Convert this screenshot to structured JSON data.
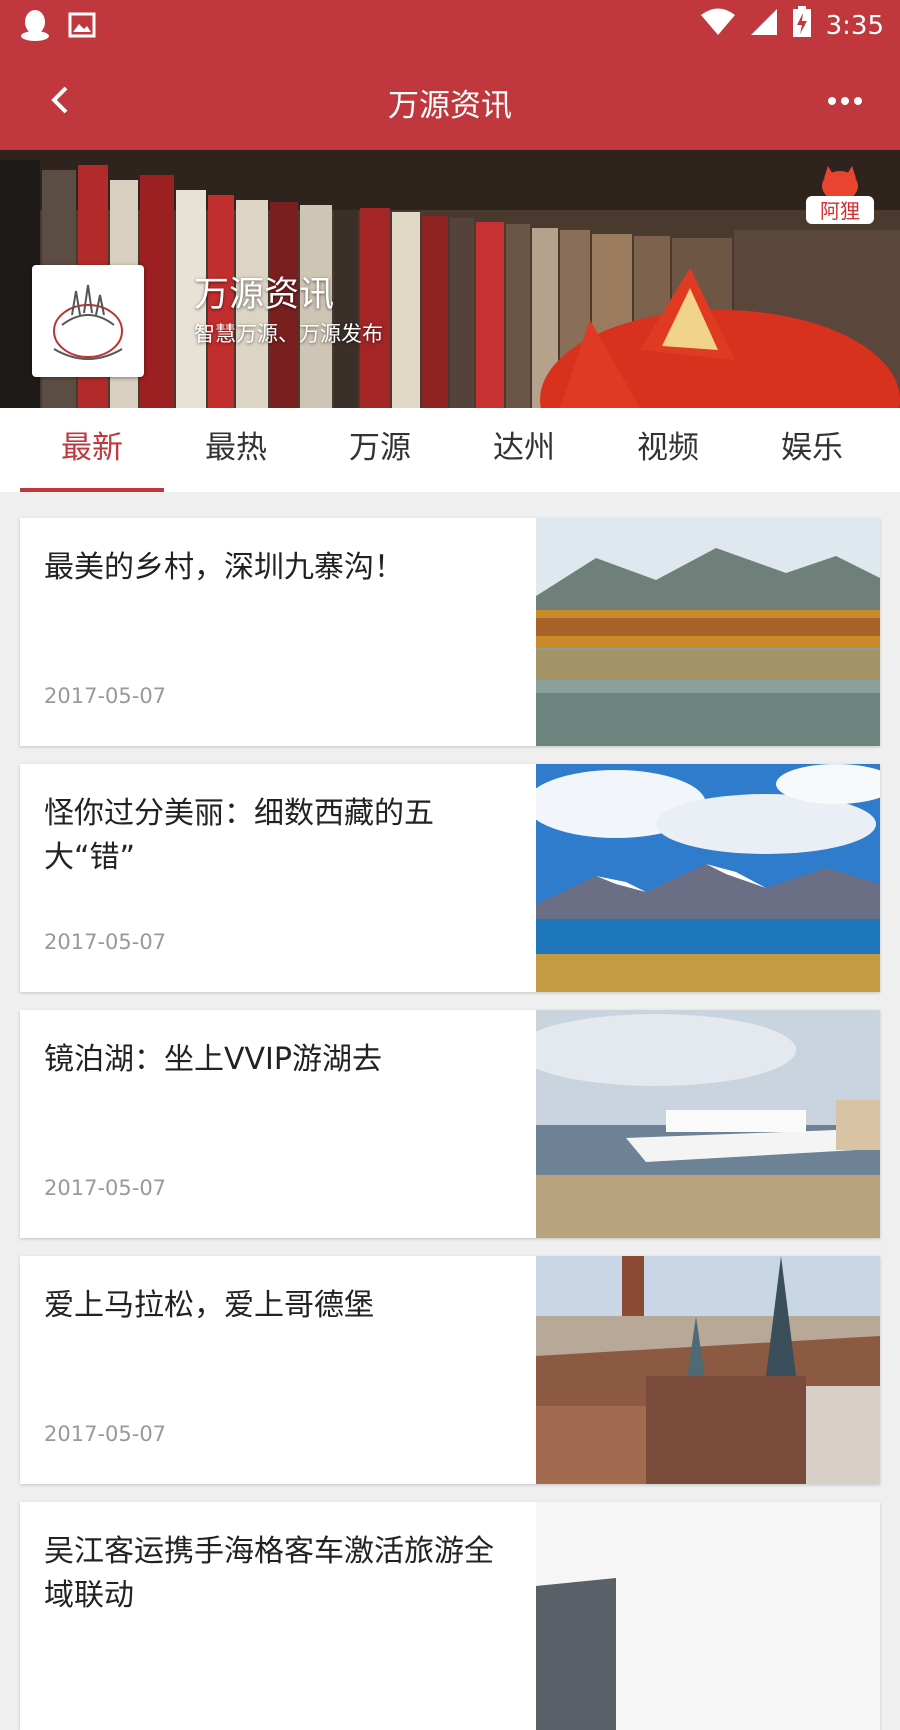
{
  "status_bar": {
    "time": "3:35",
    "left_icons": [
      "qq-penguin-icon",
      "image-icon"
    ],
    "right_icons": [
      "wifi-icon",
      "signal-icon",
      "battery-charging-icon"
    ]
  },
  "app_bar": {
    "title": "万源资讯",
    "back_icon": "chevron-left-icon",
    "more_icon": "more-horizontal-icon",
    "color": "#c0373d"
  },
  "banner": {
    "channel_name": "万源资讯",
    "channel_description": "智慧万源、万源发布",
    "brand_mark": "阿狸"
  },
  "tabs": [
    {
      "label": "最新",
      "active": true
    },
    {
      "label": "最热",
      "active": false
    },
    {
      "label": "万源",
      "active": false
    },
    {
      "label": "达州",
      "active": false
    },
    {
      "label": "视频",
      "active": false
    },
    {
      "label": "娱乐",
      "active": false
    }
  ],
  "articles": [
    {
      "title": "最美的乡村，深圳九寨沟！",
      "date": "2017-05-07",
      "thumbnail": "mountain-lake-autumn-photo"
    },
    {
      "title": "怪你过分美丽：细数西藏的五大“错”",
      "date": "2017-05-07",
      "thumbnail": "tibet-lake-snow-mountains-photo"
    },
    {
      "title": "镜泊湖：坐上VVIP游湖去",
      "date": "2017-05-07",
      "thumbnail": "ferry-boat-lake-shore-photo"
    },
    {
      "title": "爱上马拉松，爱上哥德堡",
      "date": "2017-05-07",
      "thumbnail": "gothenburg-city-spires-photo"
    },
    {
      "title": "吴江客运携手海格客车激活旅游全域联动",
      "date": "",
      "thumbnail": "city-building-photo"
    }
  ]
}
